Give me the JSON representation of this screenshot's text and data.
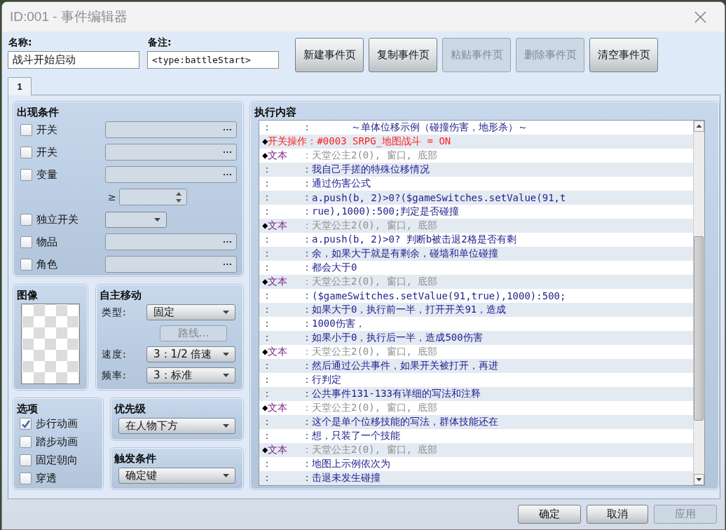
{
  "window": {
    "title": "ID:001 - 事件编辑器"
  },
  "header": {
    "name": {
      "label": "名称:",
      "value": "战斗开始启动"
    },
    "note": {
      "label": "备注:",
      "value": "<type:battleStart>"
    },
    "buttons": [
      {
        "label": "新建事件页",
        "disabled": false
      },
      {
        "label": "复制事件页",
        "disabled": false
      },
      {
        "label": "粘贴事件页",
        "disabled": true
      },
      {
        "label": "删除事件页",
        "disabled": true
      },
      {
        "label": "清空事件页",
        "disabled": false
      }
    ]
  },
  "tabs": [
    {
      "label": "1",
      "selected": true
    }
  ],
  "conditions": {
    "title": "出现条件",
    "rows": [
      {
        "kind": "picker",
        "label": "开关",
        "checked": false
      },
      {
        "kind": "picker",
        "label": "开关",
        "checked": false
      },
      {
        "kind": "picker",
        "label": "变量",
        "checked": false
      },
      {
        "kind": "spinner",
        "symbol": "≥"
      },
      {
        "kind": "dropdown",
        "label": "独立开关",
        "checked": false
      },
      {
        "kind": "picker",
        "label": "物品",
        "checked": false
      },
      {
        "kind": "picker",
        "label": "角色",
        "checked": false
      }
    ]
  },
  "image": {
    "title": "图像"
  },
  "movement": {
    "title": "自主移动",
    "type": {
      "label": "类型:",
      "value": "固定"
    },
    "route_button": {
      "label": "路线...",
      "disabled": true
    },
    "speed": {
      "label": "速度:",
      "value": "3：1/2 倍速"
    },
    "frequency": {
      "label": "频率:",
      "value": "3：标准"
    }
  },
  "options": {
    "title": "选项",
    "items": [
      {
        "label": "步行动画",
        "checked": true
      },
      {
        "label": "踏步动画",
        "checked": false
      },
      {
        "label": "固定朝向",
        "checked": false
      },
      {
        "label": "穿透",
        "checked": false
      }
    ]
  },
  "priority": {
    "title": "优先级",
    "value": "在人物下方"
  },
  "trigger": {
    "title": "触发条件",
    "value": "确定键"
  },
  "contents": {
    "title": "执行内容",
    "rows": [
      {
        "kind": "line",
        "lead": "：",
        "sep": "：",
        "text": "　　　　～单体位移示例（碰撞伤害，地形杀）～"
      },
      {
        "kind": "switch",
        "lead": "◆",
        "command": "开关操作",
        "sep": "：",
        "text": "#0003 SRPG_地图战斗 = ON"
      },
      {
        "kind": "text",
        "lead": "◆",
        "command": "文本",
        "sep": "：",
        "text": "天堂公主2(0), 窗口, 底部"
      },
      {
        "kind": "line",
        "lead": "：",
        "sep": "：",
        "text": "我自己手搓的特殊位移情况"
      },
      {
        "kind": "line",
        "lead": "：",
        "sep": "：",
        "text": "通过伤害公式"
      },
      {
        "kind": "line",
        "lead": "：",
        "sep": "：",
        "text": "a.push(b, 2)>0?($gameSwitches.setValue(91,t"
      },
      {
        "kind": "line",
        "lead": "：",
        "sep": "：",
        "text": "rue),1000):500;判定是否碰撞"
      },
      {
        "kind": "text",
        "lead": "◆",
        "command": "文本",
        "sep": "：",
        "text": "天堂公主2(0), 窗口, 底部"
      },
      {
        "kind": "line",
        "lead": "：",
        "sep": "：",
        "text": "a.push(b, 2)>0? 判断b被击退2格是否有剩"
      },
      {
        "kind": "line",
        "lead": "：",
        "sep": "：",
        "text": "余，如果大于就是有剩余，碰墙和单位碰撞"
      },
      {
        "kind": "line",
        "lead": "：",
        "sep": "：",
        "text": "都会大于0"
      },
      {
        "kind": "text",
        "lead": "◆",
        "command": "文本",
        "sep": "：",
        "text": "天堂公主2(0), 窗口, 底部"
      },
      {
        "kind": "line",
        "lead": "：",
        "sep": "：",
        "text": "($gameSwitches.setValue(91,true),1000):500;"
      },
      {
        "kind": "line",
        "lead": "：",
        "sep": "：",
        "text": "如果大于0，执行前一半，打开开关91，造成"
      },
      {
        "kind": "line",
        "lead": "：",
        "sep": "：",
        "text": "1000伤害，"
      },
      {
        "kind": "line",
        "lead": "：",
        "sep": "：",
        "text": "如果小于0，执行后一半，造成500伤害"
      },
      {
        "kind": "text",
        "lead": "◆",
        "command": "文本",
        "sep": "：",
        "text": "天堂公主2(0), 窗口, 底部"
      },
      {
        "kind": "line",
        "lead": "：",
        "sep": "：",
        "text": "然后通过公共事件，如果开关被打开，再进"
      },
      {
        "kind": "line",
        "lead": "：",
        "sep": "：",
        "text": "行判定"
      },
      {
        "kind": "line",
        "lead": "：",
        "sep": "：",
        "text": "公共事件131-133有详细的写法和注释"
      },
      {
        "kind": "text",
        "lead": "◆",
        "command": "文本",
        "sep": "：",
        "text": "天堂公主2(0), 窗口, 底部"
      },
      {
        "kind": "line",
        "lead": "：",
        "sep": "：",
        "text": "这个是单个位移技能的写法，群体技能还在"
      },
      {
        "kind": "line",
        "lead": "：",
        "sep": "：",
        "text": "想，只装了一个技能"
      },
      {
        "kind": "text",
        "lead": "◆",
        "command": "文本",
        "sep": "：",
        "text": "天堂公主2(0), 窗口, 底部"
      },
      {
        "kind": "line",
        "lead": "：",
        "sep": "：",
        "text": "地图上示例依次为"
      },
      {
        "kind": "line",
        "lead": "：",
        "sep": "：",
        "text": "击退未发生碰撞"
      }
    ]
  },
  "footer": {
    "buttons": [
      {
        "label": "确定",
        "disabled": false
      },
      {
        "label": "取消",
        "disabled": false
      },
      {
        "label": "应用",
        "disabled": true
      }
    ]
  }
}
